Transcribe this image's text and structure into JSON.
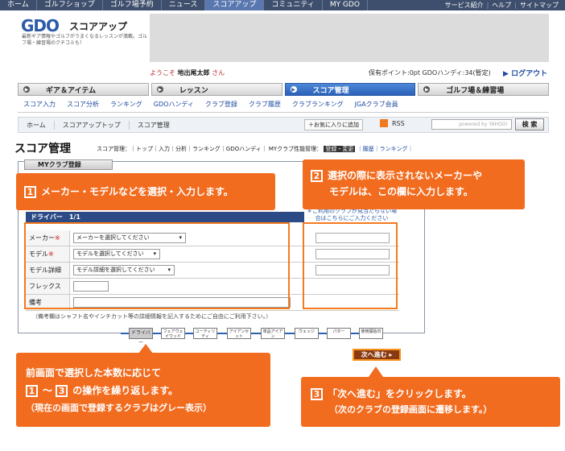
{
  "topnav": {
    "items": [
      "ホーム",
      "ゴルフショップ",
      "ゴルフ場予約",
      "ニュース",
      "スコアアップ",
      "コミュニティ",
      "MY GDO"
    ],
    "active_index": 4,
    "right_links": [
      "サービス紹介",
      "ヘルプ",
      "サイトマップ"
    ]
  },
  "header": {
    "logo": "GDO",
    "logo_sub": "スコアアップ",
    "tagline": "最新ギア情報やゴルフがうまくなるレッスンが満載。ゴルフ場・練習場のクチコミも！",
    "welcome_prefix": "ようこそ",
    "user_name": "地出尾太郎",
    "welcome_suffix": "さん",
    "points": "保有ポイント:0pt  GDOハンディ:34(暫定)",
    "logout": "ログアウト"
  },
  "main_tabs": [
    {
      "label": "ギア＆アイテム"
    },
    {
      "label": "レッスン"
    },
    {
      "label": "スコア管理"
    },
    {
      "label": "ゴルフ場＆練習場"
    }
  ],
  "main_tabs_active": 2,
  "subnav": [
    "スコア入力",
    "スコア分析",
    "ランキング",
    "GDOハンディ",
    "クラブ登録",
    "クラブ履歴",
    "クラブランキング",
    "JGAクラブ会員"
  ],
  "breadcrumb": [
    "ホーム",
    "スコアアップトップ",
    "スコア管理"
  ],
  "toolbar": {
    "favorite": "お気に入りに追加",
    "rss": "RSS",
    "search_placeholder": "powered by YAHOO!",
    "search_button": "検 索"
  },
  "page": {
    "title": "スコア管理",
    "links_text_a": "スコア管理：｜トップ｜入力｜分析｜ランキング｜GDOハンディ｜",
    "links_label_b": "MYクラブ性能管理：",
    "links_hl": "登録・変更",
    "links_text_b": "｜履歴｜ランキング｜"
  },
  "form": {
    "tab": "MYクラブ登録",
    "section": "ドライバー　1/1",
    "note_head": "＊ご利用のクラブが見当たらない場合はこちらにご入力ください",
    "rows": [
      {
        "label": "メーカー",
        "required": "※",
        "select": "メーカーを選択してください"
      },
      {
        "label": "モデル",
        "required": "※",
        "select": "モデルを選択してください"
      },
      {
        "label": "モデル詳細",
        "required": "",
        "select": "モデル詳細を選択してください"
      },
      {
        "label": "フレックス",
        "required": "",
        "select": ""
      },
      {
        "label": "備考",
        "required": "",
        "select": ""
      }
    ],
    "remark": "（備考欄はシャフト名やインチカット等の詳細情報を記入するためにご自由にご利用下さい。）",
    "steps": [
      "ドライバー",
      "フェアウェイウッド",
      "ユーティリティ",
      "アイアンセット",
      "単品アイアン",
      "ウェッジ",
      "パター",
      "使用開始日"
    ],
    "next": "次へ進む"
  },
  "callouts": {
    "c1": {
      "num": "1",
      "text": "メーカー・モデルなどを選択・入力します。"
    },
    "c2": {
      "num": "2",
      "line1": "選択の際に表示されないメーカーや",
      "line2": "モデルは、この欄に入力します。"
    },
    "c3": {
      "line1": "前画面で選択した本数に応じて",
      "num_a": "1",
      "tilde": "～",
      "num_b": "3",
      "line2_suffix": "の操作を繰り返します。",
      "line3": "（現在の画面で登録するクラブはグレー表示）"
    },
    "c4": {
      "num": "3",
      "line1": "「次へ進む」をクリックします。",
      "line2": "（次のクラブの登録画面に遷移します。）"
    }
  }
}
